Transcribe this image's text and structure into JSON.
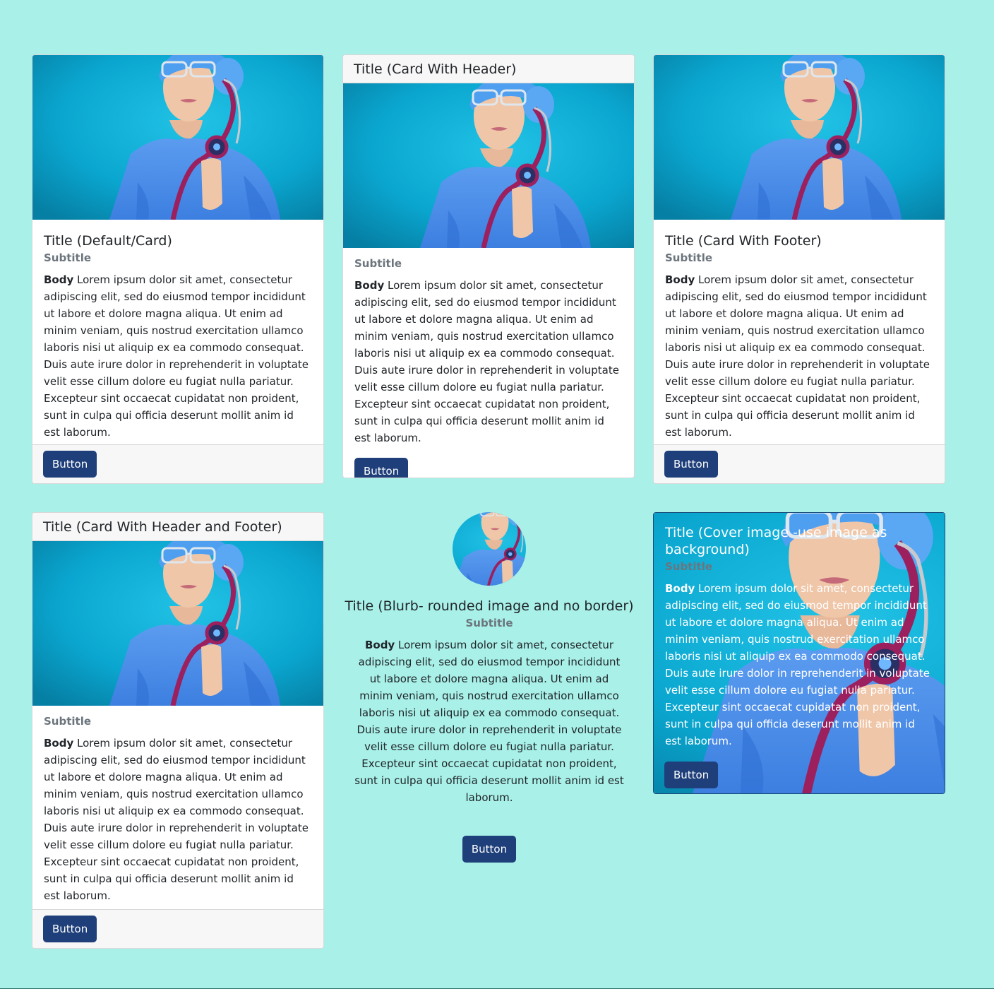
{
  "cards": {
    "default": {
      "title": "Title (Default/Card)",
      "subtitle": "Subtitle",
      "body_bold": "Body",
      "body": " Lorem ipsum dolor sit amet, consectetur adipiscing elit, sed do eiusmod tempor incididunt ut labore et dolore magna aliqua. Ut enim ad minim veniam, quis nostrud exercitation ullamco laboris nisi ut aliquip ex ea commodo consequat. Duis aute irure dolor in reprehenderit in voluptate velit esse cillum dolore eu fugiat nulla pariatur. Excepteur sint occaecat cupidatat non proident, sunt in culpa qui officia deserunt mollit anim id est laborum.",
      "button": "Button"
    },
    "with_header": {
      "title": "Title (Card With Header)",
      "subtitle": "Subtitle",
      "body_bold": "Body",
      "body": " Lorem ipsum dolor sit amet, consectetur adipiscing elit, sed do eiusmod tempor incididunt ut labore et dolore magna aliqua. Ut enim ad minim veniam, quis nostrud exercitation ullamco laboris nisi ut aliquip ex ea commodo consequat. Duis aute irure dolor in reprehenderit in voluptate velit esse cillum dolore eu fugiat nulla pariatur. Excepteur sint occaecat cupidatat non proident, sunt in culpa qui officia deserunt mollit anim id est laborum.",
      "button": "Button"
    },
    "with_footer": {
      "title": "Title (Card With Footer)",
      "subtitle": "Subtitle",
      "body_bold": "Body",
      "body": " Lorem ipsum dolor sit amet, consectetur adipiscing elit, sed do eiusmod tempor incididunt ut labore et dolore magna aliqua. Ut enim ad minim veniam, quis nostrud exercitation ullamco laboris nisi ut aliquip ex ea commodo consequat. Duis aute irure dolor in reprehenderit in voluptate velit esse cillum dolore eu fugiat nulla pariatur. Excepteur sint occaecat cupidatat non proident, sunt in culpa qui officia deserunt mollit anim id est laborum.",
      "button": "Button"
    },
    "header_footer": {
      "title": "Title (Card With Header and Footer)",
      "subtitle": "Subtitle",
      "body_bold": "Body",
      "body": " Lorem ipsum dolor sit amet, consectetur adipiscing elit, sed do eiusmod tempor incididunt ut labore et dolore magna aliqua. Ut enim ad minim veniam, quis nostrud exercitation ullamco laboris nisi ut aliquip ex ea commodo consequat. Duis aute irure dolor in reprehenderit in voluptate velit esse cillum dolore eu fugiat nulla pariatur. Excepteur sint occaecat cupidatat non proident, sunt in culpa qui officia deserunt mollit anim id est laborum.",
      "button": "Button"
    },
    "blurb": {
      "title": "Title (Blurb- rounded image and no border)",
      "subtitle": "Subtitle",
      "body_bold": "Body",
      "body": " Lorem ipsum dolor sit amet, consectetur adipiscing elit, sed do eiusmod tempor incididunt ut labore et dolore magna aliqua. Ut enim ad minim veniam, quis nostrud exercitation ullamco laboris nisi ut aliquip ex ea commodo consequat. Duis aute irure dolor in reprehenderit in voluptate velit esse cillum dolore eu fugiat nulla pariatur. Excepteur sint occaecat cupidatat non proident, sunt in culpa qui officia deserunt mollit anim id est laborum.",
      "button": "Button"
    },
    "cover": {
      "title": "Title (Cover image -use image as background)",
      "subtitle": "Subtitle",
      "body_bold": "Body",
      "body": " Lorem ipsum dolor sit amet, consectetur adipiscing elit, sed do eiusmod tempor incididunt ut labore et dolore magna aliqua. Ut enim ad minim veniam, quis nostrud exercitation ullamco laboris nisi ut aliquip ex ea commodo consequat. Duis aute irure dolor in reprehenderit in voluptate velit esse cillum dolore eu fugiat nulla pariatur. Excepteur sint occaecat cupidatat non proident, sunt in culpa qui officia deserunt mollit anim id est laborum.",
      "button": "Button"
    }
  },
  "colors": {
    "page_background": "#a8f0e8",
    "button": "#1e3f7a",
    "header_footer": "#f7f7f7",
    "subtitle": "#6c757d"
  },
  "icons": {
    "card_image": "doctor-photo"
  }
}
